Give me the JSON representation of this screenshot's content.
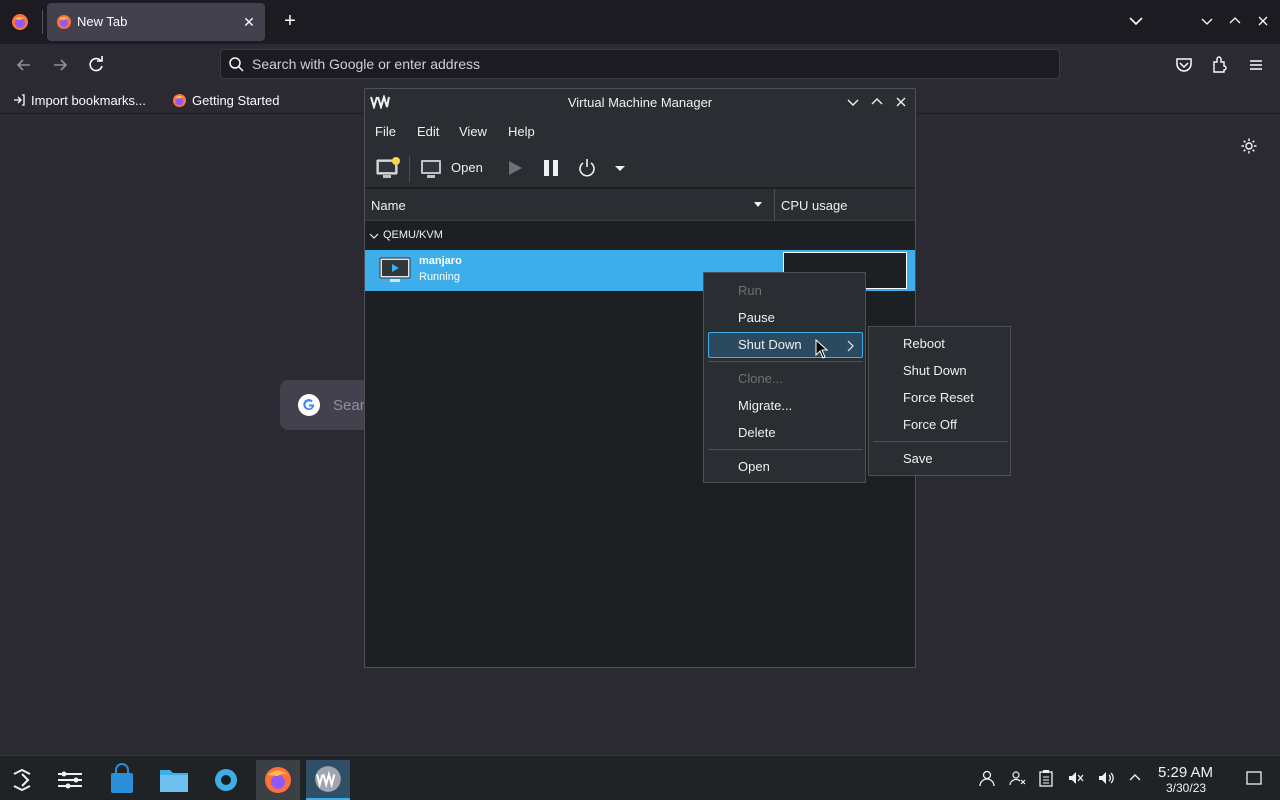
{
  "browser": {
    "tab": {
      "title": "New Tab"
    },
    "urlbar": {
      "placeholder": "Search with Google or enter address"
    },
    "bookmarks": [
      {
        "label": "Import bookmarks...",
        "icon": "import-icon"
      },
      {
        "label": "Getting Started",
        "icon": "firefox-icon"
      }
    ],
    "newtab": {
      "search_placeholder": "Sear"
    }
  },
  "vmm": {
    "title": "Virtual Machine Manager",
    "menus": [
      "File",
      "Edit",
      "View",
      "Help"
    ],
    "toolbar": {
      "open_label": "Open"
    },
    "columns": {
      "name": "Name",
      "cpu": "CPU usage"
    },
    "group": "QEMU/KVM",
    "vm": {
      "name": "manjaro",
      "status": "Running"
    }
  },
  "context_menu": {
    "items": [
      {
        "label": "Run",
        "enabled": false
      },
      {
        "label": "Pause",
        "enabled": true
      },
      {
        "label": "Shut Down",
        "enabled": true,
        "active": true,
        "submenu": true
      },
      {
        "label": "Clone...",
        "enabled": false
      },
      {
        "label": "Migrate...",
        "enabled": true
      },
      {
        "label": "Delete",
        "enabled": true
      },
      {
        "label": "Open",
        "enabled": true
      }
    ]
  },
  "shutdown_submenu": {
    "items": [
      "Reboot",
      "Shut Down",
      "Force Reset",
      "Force Off",
      "Save"
    ]
  },
  "taskbar": {
    "clock": {
      "time": "5:29 AM",
      "date": "3/30/23"
    }
  },
  "colors": {
    "accent": "#3daee9",
    "firefox_bg": "#2b2a33",
    "window_bg": "#1d2023"
  }
}
